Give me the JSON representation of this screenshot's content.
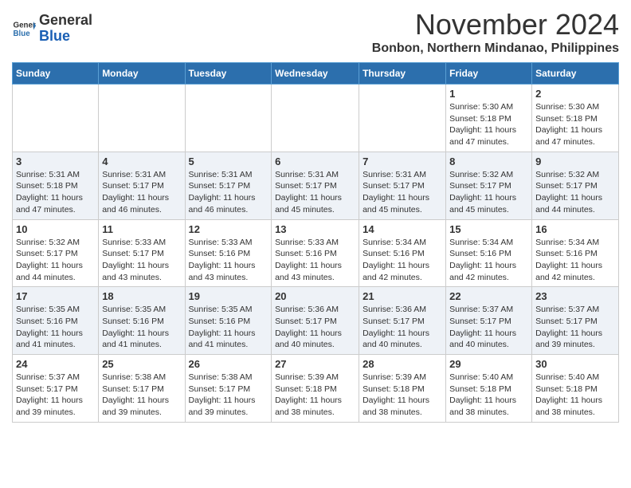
{
  "header": {
    "logo_general": "General",
    "logo_blue": "Blue",
    "month_title": "November 2024",
    "location": "Bonbon, Northern Mindanao, Philippines"
  },
  "calendar": {
    "days_of_week": [
      "Sunday",
      "Monday",
      "Tuesday",
      "Wednesday",
      "Thursday",
      "Friday",
      "Saturday"
    ],
    "weeks": [
      [
        {
          "day": "",
          "info": ""
        },
        {
          "day": "",
          "info": ""
        },
        {
          "day": "",
          "info": ""
        },
        {
          "day": "",
          "info": ""
        },
        {
          "day": "",
          "info": ""
        },
        {
          "day": "1",
          "info": "Sunrise: 5:30 AM\nSunset: 5:18 PM\nDaylight: 11 hours and 47 minutes."
        },
        {
          "day": "2",
          "info": "Sunrise: 5:30 AM\nSunset: 5:18 PM\nDaylight: 11 hours and 47 minutes."
        }
      ],
      [
        {
          "day": "3",
          "info": "Sunrise: 5:31 AM\nSunset: 5:18 PM\nDaylight: 11 hours and 47 minutes."
        },
        {
          "day": "4",
          "info": "Sunrise: 5:31 AM\nSunset: 5:17 PM\nDaylight: 11 hours and 46 minutes."
        },
        {
          "day": "5",
          "info": "Sunrise: 5:31 AM\nSunset: 5:17 PM\nDaylight: 11 hours and 46 minutes."
        },
        {
          "day": "6",
          "info": "Sunrise: 5:31 AM\nSunset: 5:17 PM\nDaylight: 11 hours and 45 minutes."
        },
        {
          "day": "7",
          "info": "Sunrise: 5:31 AM\nSunset: 5:17 PM\nDaylight: 11 hours and 45 minutes."
        },
        {
          "day": "8",
          "info": "Sunrise: 5:32 AM\nSunset: 5:17 PM\nDaylight: 11 hours and 45 minutes."
        },
        {
          "day": "9",
          "info": "Sunrise: 5:32 AM\nSunset: 5:17 PM\nDaylight: 11 hours and 44 minutes."
        }
      ],
      [
        {
          "day": "10",
          "info": "Sunrise: 5:32 AM\nSunset: 5:17 PM\nDaylight: 11 hours and 44 minutes."
        },
        {
          "day": "11",
          "info": "Sunrise: 5:33 AM\nSunset: 5:17 PM\nDaylight: 11 hours and 43 minutes."
        },
        {
          "day": "12",
          "info": "Sunrise: 5:33 AM\nSunset: 5:16 PM\nDaylight: 11 hours and 43 minutes."
        },
        {
          "day": "13",
          "info": "Sunrise: 5:33 AM\nSunset: 5:16 PM\nDaylight: 11 hours and 43 minutes."
        },
        {
          "day": "14",
          "info": "Sunrise: 5:34 AM\nSunset: 5:16 PM\nDaylight: 11 hours and 42 minutes."
        },
        {
          "day": "15",
          "info": "Sunrise: 5:34 AM\nSunset: 5:16 PM\nDaylight: 11 hours and 42 minutes."
        },
        {
          "day": "16",
          "info": "Sunrise: 5:34 AM\nSunset: 5:16 PM\nDaylight: 11 hours and 42 minutes."
        }
      ],
      [
        {
          "day": "17",
          "info": "Sunrise: 5:35 AM\nSunset: 5:16 PM\nDaylight: 11 hours and 41 minutes."
        },
        {
          "day": "18",
          "info": "Sunrise: 5:35 AM\nSunset: 5:16 PM\nDaylight: 11 hours and 41 minutes."
        },
        {
          "day": "19",
          "info": "Sunrise: 5:35 AM\nSunset: 5:16 PM\nDaylight: 11 hours and 41 minutes."
        },
        {
          "day": "20",
          "info": "Sunrise: 5:36 AM\nSunset: 5:17 PM\nDaylight: 11 hours and 40 minutes."
        },
        {
          "day": "21",
          "info": "Sunrise: 5:36 AM\nSunset: 5:17 PM\nDaylight: 11 hours and 40 minutes."
        },
        {
          "day": "22",
          "info": "Sunrise: 5:37 AM\nSunset: 5:17 PM\nDaylight: 11 hours and 40 minutes."
        },
        {
          "day": "23",
          "info": "Sunrise: 5:37 AM\nSunset: 5:17 PM\nDaylight: 11 hours and 39 minutes."
        }
      ],
      [
        {
          "day": "24",
          "info": "Sunrise: 5:37 AM\nSunset: 5:17 PM\nDaylight: 11 hours and 39 minutes."
        },
        {
          "day": "25",
          "info": "Sunrise: 5:38 AM\nSunset: 5:17 PM\nDaylight: 11 hours and 39 minutes."
        },
        {
          "day": "26",
          "info": "Sunrise: 5:38 AM\nSunset: 5:17 PM\nDaylight: 11 hours and 39 minutes."
        },
        {
          "day": "27",
          "info": "Sunrise: 5:39 AM\nSunset: 5:18 PM\nDaylight: 11 hours and 38 minutes."
        },
        {
          "day": "28",
          "info": "Sunrise: 5:39 AM\nSunset: 5:18 PM\nDaylight: 11 hours and 38 minutes."
        },
        {
          "day": "29",
          "info": "Sunrise: 5:40 AM\nSunset: 5:18 PM\nDaylight: 11 hours and 38 minutes."
        },
        {
          "day": "30",
          "info": "Sunrise: 5:40 AM\nSunset: 5:18 PM\nDaylight: 11 hours and 38 minutes."
        }
      ]
    ]
  }
}
